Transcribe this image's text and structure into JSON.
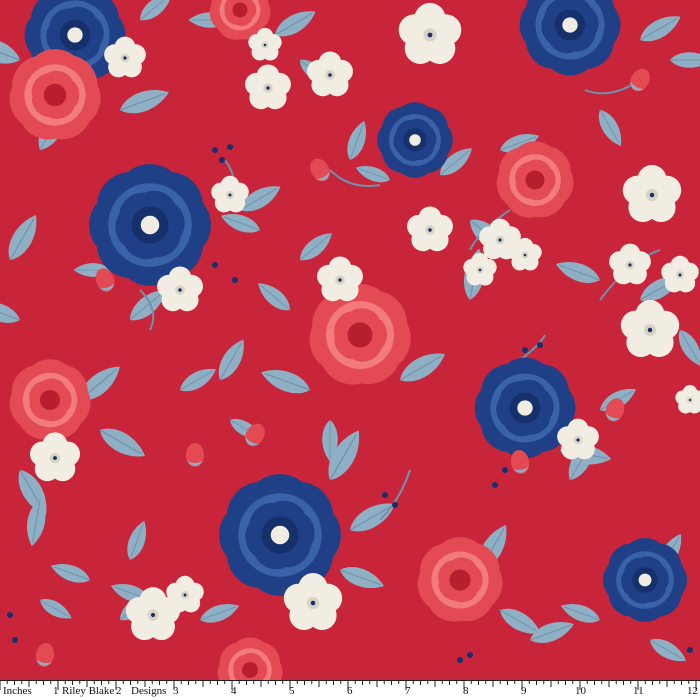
{
  "colors": {
    "background": "#c8253a",
    "navy": "#1f3f87",
    "navy_dark": "#16306b",
    "navy_light": "#3a62a8",
    "coral": "#e34a54",
    "coral_dark": "#b81f2e",
    "coral_light": "#f27b7c",
    "cream": "#f1ede3",
    "leaf": "#8fb0c4",
    "leaf_dark": "#6e93ab",
    "ruler_bg": "#ffffff"
  },
  "ruler": {
    "unit_label": "Inches",
    "brand_label_1": "Riley Blake",
    "brand_label_2": "Designs",
    "numbers": [
      "1",
      "2",
      "3",
      "4",
      "5",
      "6",
      "7",
      "8",
      "9",
      "10",
      "11",
      "12"
    ]
  }
}
